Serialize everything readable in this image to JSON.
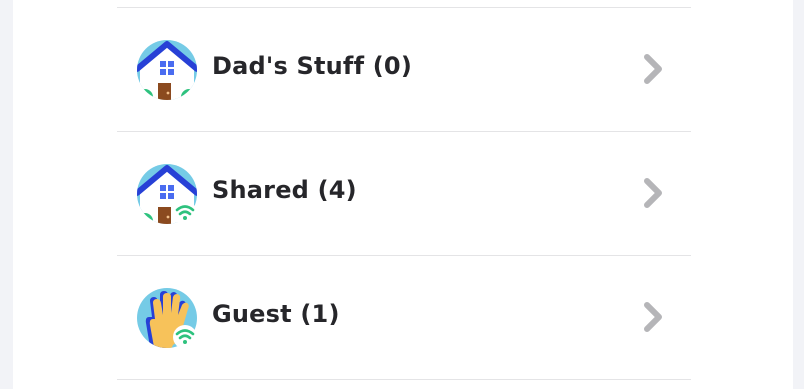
{
  "profiles": [
    {
      "label": "Dad's Stuff (0)",
      "icon": "house-icon",
      "shared": false
    },
    {
      "label": "Shared (4)",
      "icon": "house-wifi-icon",
      "shared": true
    },
    {
      "label": "Guest (1)",
      "icon": "waving-hand-wifi-icon",
      "shared": true
    }
  ],
  "colors": {
    "avatar_bg": "#75cbe6",
    "roof": "#2740d6",
    "door": "#8b4a1f",
    "wifi": "#2ec27e",
    "chevron": "#b5b5b8",
    "text": "#26262a",
    "divider": "#e4e4e6"
  }
}
